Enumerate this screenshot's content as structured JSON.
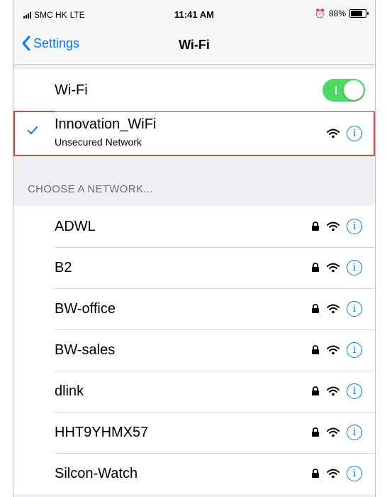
{
  "status_bar": {
    "carrier": "SMC HK",
    "network": "LTE",
    "time": "11:41 AM",
    "battery_text": "88%",
    "battery_level": 0.88
  },
  "nav": {
    "back_label": "Settings",
    "title": "Wi-Fi"
  },
  "wifi_toggle": {
    "label": "Wi-Fi",
    "on": true,
    "accent": "#4cd964"
  },
  "connected": {
    "name": "Innovation_WiFi",
    "status": "Unsecured Network"
  },
  "section_header": "CHOOSE A NETWORK...",
  "networks": [
    {
      "name": "ADWL"
    },
    {
      "name": "B2"
    },
    {
      "name": "BW-office"
    },
    {
      "name": "BW-sales"
    },
    {
      "name": "dlink"
    },
    {
      "name": "HHT9YHMX57"
    },
    {
      "name": "Silcon-Watch"
    }
  ],
  "icons": {
    "back": "chevron-left-icon",
    "check": "checkmark-icon",
    "lock": "lock-icon",
    "wifi": "wifi-icon",
    "info": "info-icon",
    "lock_color": "#000000",
    "info_color": "#007aff"
  }
}
